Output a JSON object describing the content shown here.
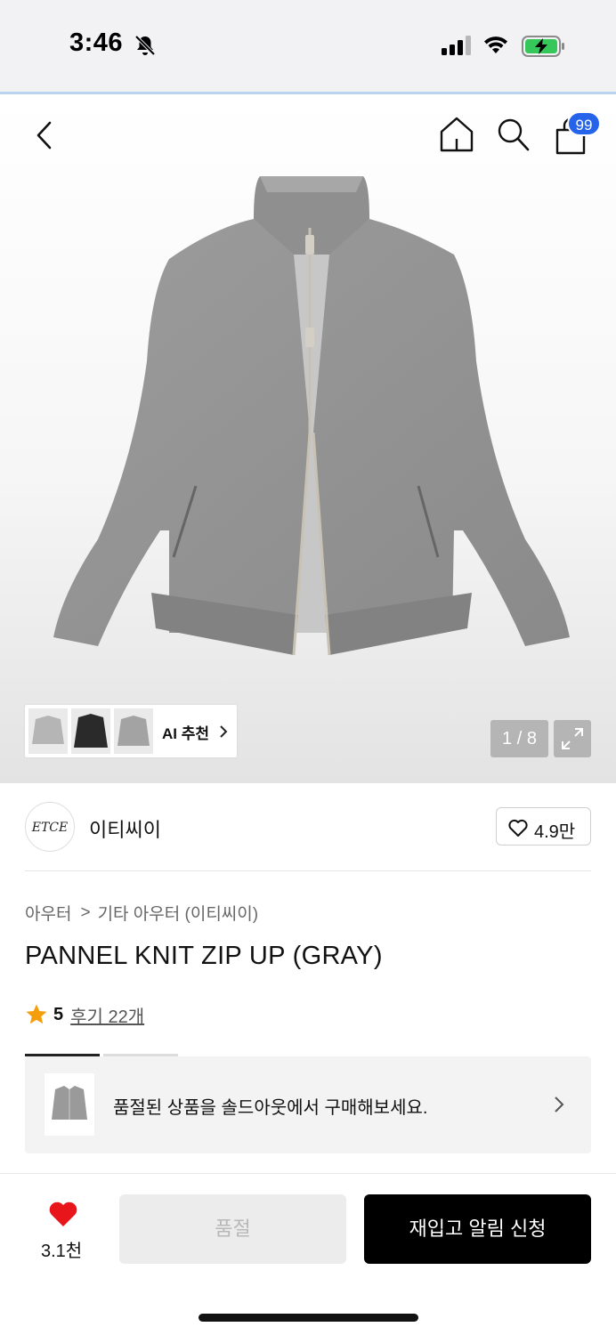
{
  "status_bar": {
    "time": "3:46"
  },
  "header": {
    "cart_count": "99"
  },
  "gallery": {
    "ai_label": "AI 추천",
    "page_indicator": "1 / 8"
  },
  "brand": {
    "logo_text": "ETCE",
    "name": "이티씨이",
    "likes": "4.9만"
  },
  "breadcrumb": {
    "level1": "아우터",
    "separator": ">",
    "level2": "기타 아우터 (이티씨이)"
  },
  "product": {
    "title": "PANNEL KNIT ZIP UP (GRAY)",
    "rating": "5",
    "reviews": "후기 22개"
  },
  "soldout_banner": {
    "text": "품절된 상품을 솔드아웃에서 구매해보세요."
  },
  "bottom_bar": {
    "wish_count": "3.1천",
    "soldout_label": "품절",
    "restock_label": "재입고 알림 신청"
  },
  "colors": {
    "accent_blue": "#2563eb",
    "heart_red": "#e8151b",
    "star_orange": "#f59e0b"
  }
}
